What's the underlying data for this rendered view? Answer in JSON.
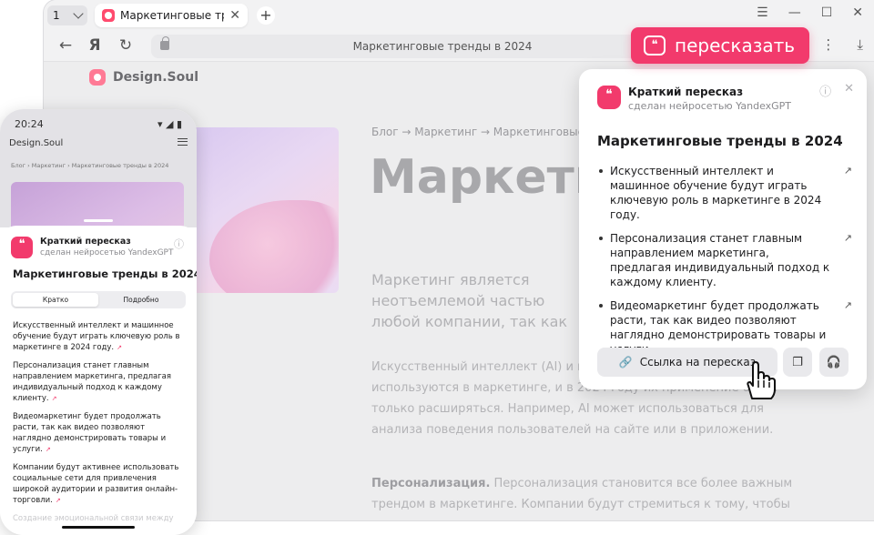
{
  "browser": {
    "tab_count": "1",
    "tab_title": "Маркетинговые тренды",
    "address": "Маркетинговые тренды в 2024"
  },
  "badge": {
    "label": "пересказать"
  },
  "site": {
    "brand": "Design.Soul",
    "breadcrumbs": "Блог → Маркетинг → Маркетинговые",
    "headline": "Маркетинговые тренды в",
    "lead": "Маркетинг является неотъемлемой частью любой компании, так как именно он помогает привлекать клиентов и удерживать существующих",
    "paragraph1": "Искусственный интеллект (AI) и машинное обучение уже активно используются в маркетинге, и в 2024 году их применение будет только расширяться. Например, AI может использоваться для анализа поведения пользователей на сайте или в приложении.",
    "paragraph2_bold": "Персонализация.",
    "paragraph2": " Персонализация становится все более важным трендом в маркетинге. Компании будут стремиться к тому, чтобы предлагать своим"
  },
  "popup": {
    "header_title": "Краткий пересказ",
    "header_subtitle": "сделан нейросетью YandexGPT",
    "title": "Маркетинговые тренды в 2024",
    "points": [
      "Искусственный интеллект и машинное обучение будут играть ключевую роль в маркетинге в 2024 году.",
      "Персонализация станет главным направлением маркетинга, предлагая индивидуальный подход к каждому клиенту.",
      "Видеомаркетинг будет продолжать расти, так как видео позволяют наглядно демонстрировать товары и услуги."
    ],
    "link_button": "Ссылка на пересказ"
  },
  "phone": {
    "time": "20:24",
    "brand": "Design.Soul",
    "breadcrumbs": "Блог  ›  Маркетинг  ›  Маркетинговые тренды в 2024",
    "header_title": "Краткий пересказ",
    "header_subtitle": "сделан нейросетью YandexGPT",
    "title": "Маркетинговые тренды в 2024",
    "tab_short": "Кратко",
    "tab_detailed": "Подробно",
    "points": [
      "Искусственный интеллект и машинное обучение будут играть ключевую роль в маркетинге в 2024 году.",
      "Персонализация станет главным направлением маркетинга, предлагая индивидуальный подход к каждому клиенту.",
      "Видеомаркетинг будет продолжать расти, так как видео позволяют наглядно демонстрировать товары и услуги.",
      "Компании будут активнее использовать социальные сети для привлечения широкой аудитории и развития онлайн-торговли."
    ],
    "faded_point": "Создание эмоциональной связи между"
  },
  "colors": {
    "accent": "#f23a6c"
  }
}
